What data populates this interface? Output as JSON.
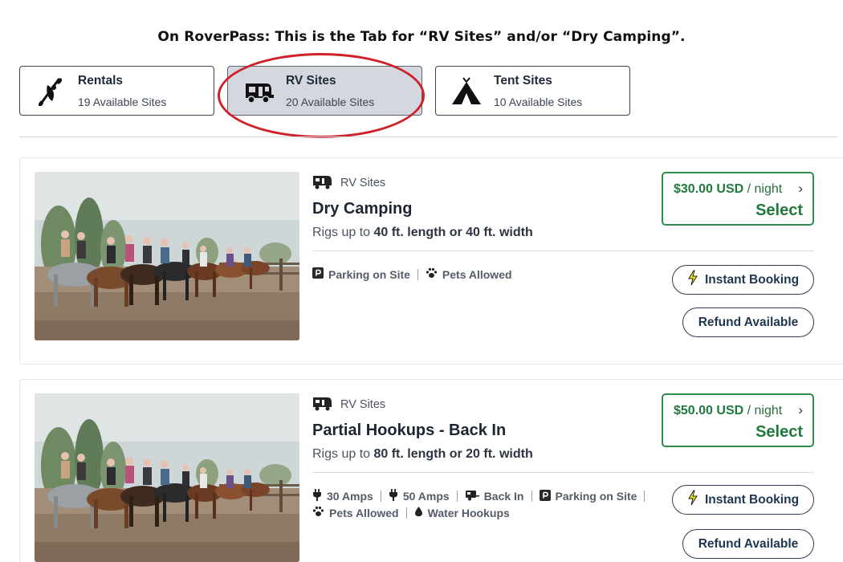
{
  "caption": "On RoverPass: This is the Tab for “RV Sites” and/or “Dry Camping”.",
  "tabs": [
    {
      "name": "Rentals",
      "count": "19 Available Sites",
      "icon": "kayak-icon",
      "active": false
    },
    {
      "name": "RV Sites",
      "count": "20 Available Sites",
      "icon": "rv-icon",
      "active": true
    },
    {
      "name": "Tent Sites",
      "count": "10 Available Sites",
      "icon": "tent-icon",
      "active": false
    }
  ],
  "colors": {
    "accent_green": "#1f7a3b",
    "highlight_red": "#d0202a",
    "active_tab_bg": "#d4d8de"
  },
  "listings": [
    {
      "category": "RV Sites",
      "title": "Dry Camping",
      "rigs_prefix": "Rigs up to ",
      "rigs_value": "40 ft. length or 40 ft. width",
      "amenities_line1": [
        {
          "icon": "parking-icon",
          "label": "Parking on Site"
        },
        {
          "icon": "paw-icon",
          "label": "Pets Allowed"
        }
      ],
      "price": "$30.00 USD",
      "price_unit": " / night",
      "select_label": "Select",
      "instant_label": "Instant Booking",
      "refund_label": "Refund Available"
    },
    {
      "category": "RV Sites",
      "title": "Partial Hookups - Back In",
      "rigs_prefix": "Rigs up to ",
      "rigs_value": "80 ft. length or 20 ft. width",
      "amenities_line1": [
        {
          "icon": "plug-icon",
          "label": "30 Amps"
        },
        {
          "icon": "plug-icon",
          "label": "50 Amps"
        },
        {
          "icon": "trailer-icon",
          "label": "Back In"
        },
        {
          "icon": "parking-icon",
          "label": "Parking on Site"
        }
      ],
      "amenities_line2": [
        {
          "icon": "paw-icon",
          "label": "Pets Allowed"
        },
        {
          "icon": "water-drop-icon",
          "label": "Water Hookups"
        }
      ],
      "price": "$50.00 USD",
      "price_unit": " / night",
      "select_label": "Select",
      "instant_label": "Instant Booking",
      "refund_label": "Refund Available"
    }
  ]
}
